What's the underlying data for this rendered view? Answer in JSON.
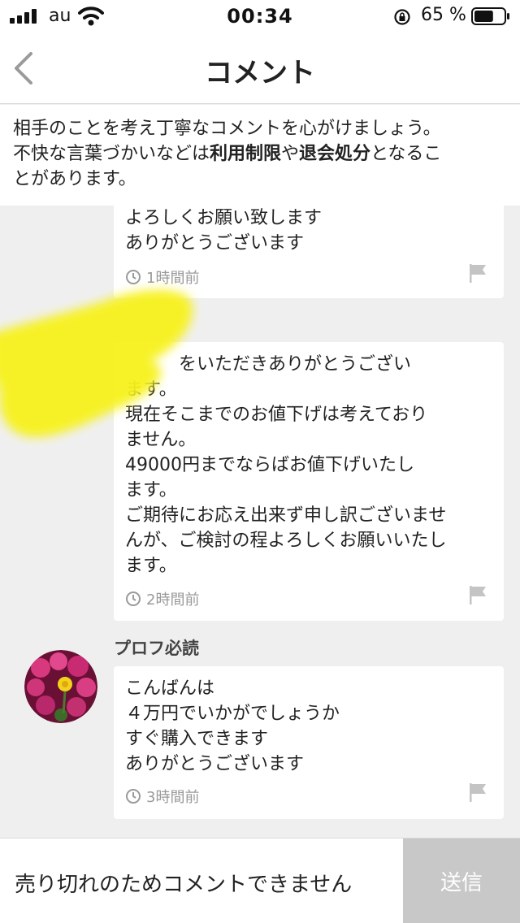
{
  "status_bar": {
    "carrier": "au",
    "time": "00:34",
    "battery_percent": "65 %",
    "battery_level": 0.65
  },
  "nav": {
    "title": "コメント"
  },
  "notice": {
    "line1": "相手のことを考え丁寧なコメントを心がけましょう。",
    "line2_prefix": "不快な言葉づかいなどは",
    "bold1": "利用制限",
    "middle": "や",
    "bold2": "退会処分",
    "suffix": "となるこ",
    "line3": "とがあります。"
  },
  "comments": [
    {
      "text": "よろしくお願い致します\nありがとうございます",
      "time": "1時間前"
    },
    {
      "text": "　　　をいただきありがとうござい\nます。\n現在そこまでのお値下げは考えており\nません。\n49000円までならばお値下げいたし\nます。\nご期待にお応え出来ず申し訳ございませ\nんが、ご検討の程よろしくお願いいたし\nます。",
      "time": "2時間前"
    },
    {
      "username": "プロフ必読",
      "text": "こんばんは\n４万円でいかがでしょうか\nすぐ購入できます\nありがとうございます",
      "time": "3時間前"
    }
  ],
  "bottom": {
    "disabled_message": "売り切れのためコメントできません",
    "send_label": "送信"
  },
  "colors": {
    "highlight": "#f7f21a",
    "send_disabled_bg": "#c8c8c8",
    "meta_text": "#9a9a9a"
  }
}
